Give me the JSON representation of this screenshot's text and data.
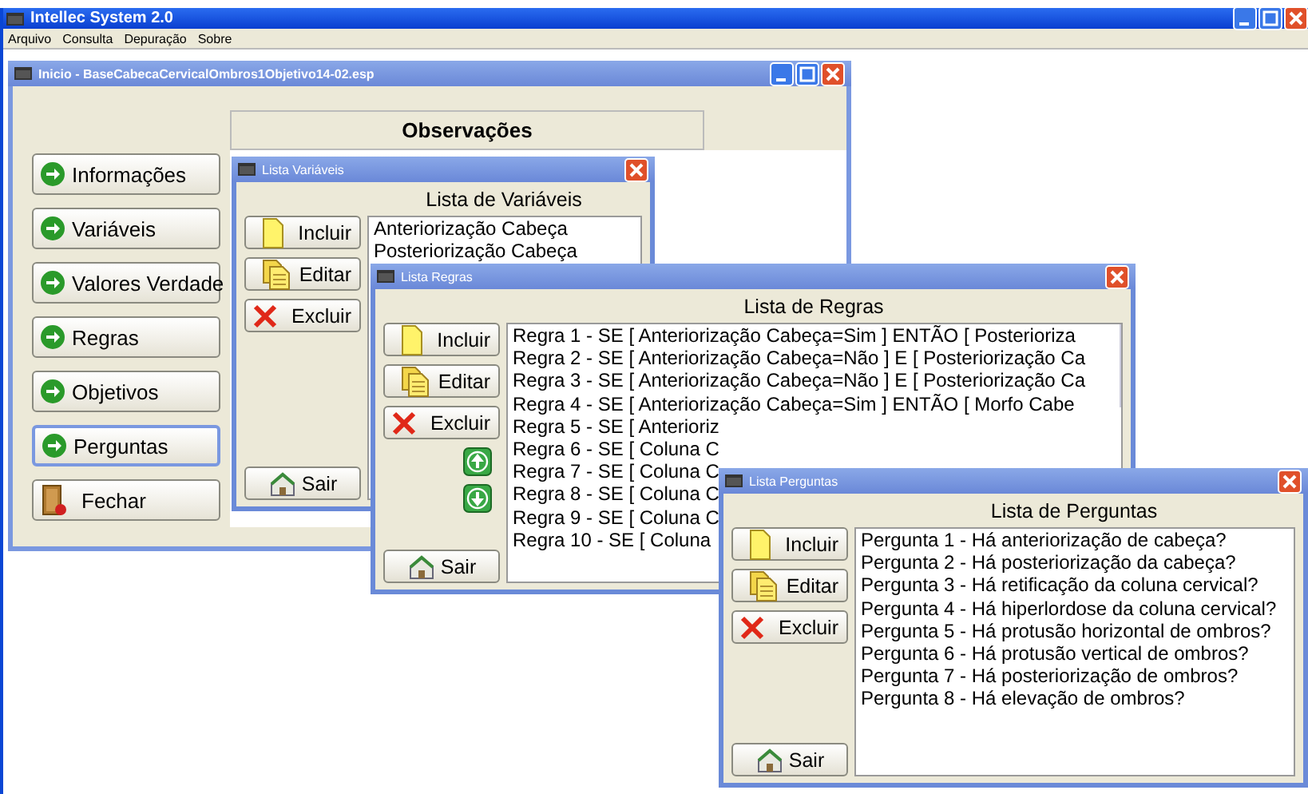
{
  "app_window": {
    "title": "Intellec System 2.0",
    "menu": [
      "Arquivo",
      "Consulta",
      "Depuração",
      "Sobre"
    ]
  },
  "main_window": {
    "title": "Inicio - BaseCabecaCervicalOmbros1Objetivo14-02.esp",
    "observations_header": "Observações",
    "nav_buttons": [
      {
        "label": "Informações",
        "kind": "go",
        "selected": false
      },
      {
        "label": "Variáveis",
        "kind": "go",
        "selected": false
      },
      {
        "label": "Valores Verdade",
        "kind": "go",
        "selected": false
      },
      {
        "label": "Regras",
        "kind": "go",
        "selected": false
      },
      {
        "label": "Objetivos",
        "kind": "go",
        "selected": false
      },
      {
        "label": "Perguntas",
        "kind": "go",
        "selected": true
      },
      {
        "label": "Fechar",
        "kind": "exit",
        "selected": false
      }
    ]
  },
  "dialogs": [
    {
      "title": "Lista Variáveis",
      "heading": "Lista de Variáveis",
      "buttons": [
        {
          "kind": "new",
          "label": "Incluir"
        },
        {
          "kind": "edit",
          "label": "Editar"
        },
        {
          "kind": "delete",
          "label": "Excluir"
        },
        {
          "kind": "exit",
          "label": "Sair"
        }
      ],
      "items": [
        "Anteriorização Cabeça",
        "Posteriorização Cabeça"
      ]
    },
    {
      "title": "Lista Regras",
      "heading": "Lista de Regras",
      "buttons": [
        {
          "kind": "new",
          "label": "Incluir"
        },
        {
          "kind": "edit",
          "label": "Editar"
        },
        {
          "kind": "delete",
          "label": "Excluir"
        },
        {
          "kind": "up"
        },
        {
          "kind": "down"
        },
        {
          "kind": "exit",
          "label": "Sair"
        }
      ],
      "items": [
        "Regra 1 - SE [ Anteriorização Cabeça=Sim ]  ENTÃO [ Posterioriza",
        "Regra 2 - SE [ Anteriorização Cabeça=Não ] E [ Posteriorização Ca",
        "Regra 3 - SE [ Anteriorização Cabeça=Não ] E [ Posteriorização Ca",
        "Regra 4 - SE [ Anteriorização Cabeça=Sim ]  ENTÃO [ Morfo Cabe",
        "Regra 5 - SE [ Anterioriz",
        "Regra 6 - SE [ Coluna C",
        "Regra 7 - SE [ Coluna C",
        "Regra 8 - SE [ Coluna C",
        "Regra 9 - SE [ Coluna C",
        "Regra 10 - SE [ Coluna"
      ]
    },
    {
      "title": "Lista Perguntas",
      "heading": "Lista de Perguntas",
      "buttons": [
        {
          "kind": "new",
          "label": "Incluir"
        },
        {
          "kind": "edit",
          "label": "Editar"
        },
        {
          "kind": "delete",
          "label": "Excluir"
        },
        {
          "kind": "exit",
          "label": "Sair"
        }
      ],
      "items": [
        "Pergunta 1 - Há anteriorização de cabeça?",
        "Pergunta 2 - Há posteriorização da cabeça?",
        "Pergunta 3 - Há retificação da coluna cervical?",
        "Pergunta 4 - Há hiperlordose da coluna cervical?",
        "Pergunta 5 - Há protusão horizontal de ombros?",
        "Pergunta 6 - Há protusão vertical de ombros?",
        "Pergunta 7 - Há posteriorização de ombros?",
        "Pergunta 8 - Há elevação de ombros?"
      ]
    }
  ]
}
